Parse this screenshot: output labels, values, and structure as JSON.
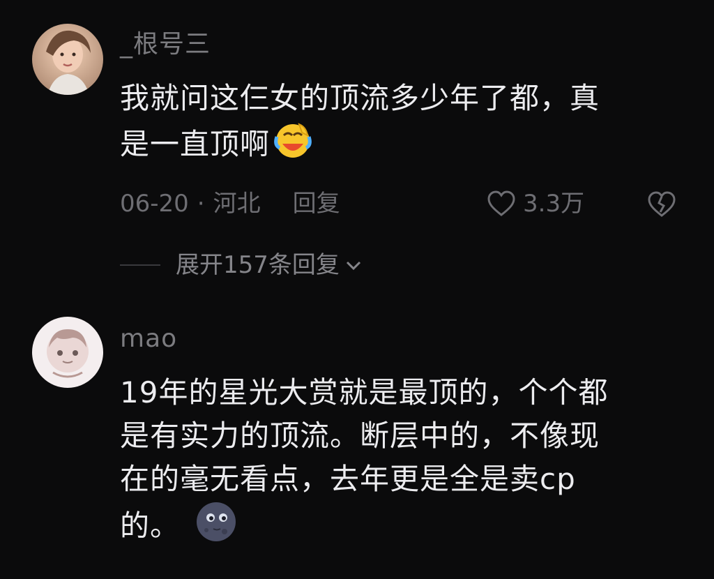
{
  "comments": [
    {
      "username": "_根号三",
      "text_lines": [
        "我就问这仨女的顶流多少年了都，真",
        "是一直顶啊"
      ],
      "emoji": "laughing-crying-emoji",
      "date": "06-20",
      "separator": "·",
      "location": "河北",
      "reply_label": "回复",
      "likes": "3.3万",
      "expand_label": "展开157条回复"
    },
    {
      "username": "mao",
      "text_lines": [
        "19年的星光大赏就是最顶的，个个都",
        "是有实力的顶流。断层中的，不像现",
        "在的毫无看点，去年更是全是卖cp",
        "的。"
      ],
      "emoji": "dark-moon-face-emoji"
    }
  ],
  "colors": {
    "background": "#0b0b0c",
    "text": "#ececef",
    "muted": "#6e6e73"
  }
}
